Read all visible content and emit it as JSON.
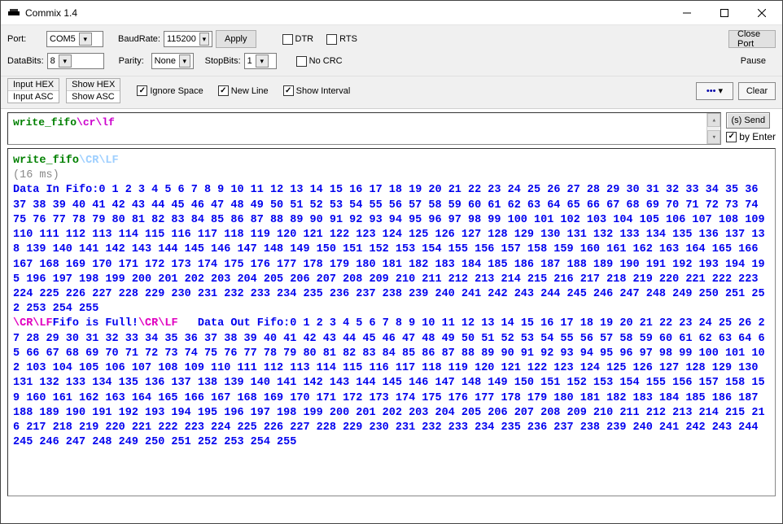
{
  "window": {
    "title": "Commix 1.4"
  },
  "toolbar": {
    "port_label": "Port:",
    "port_value": "COM5",
    "baud_label": "BaudRate:",
    "baud_value": "115200",
    "apply_label": "Apply",
    "dtr_label": "DTR",
    "rts_label": "RTS",
    "close_port_label": "Close Port",
    "databits_label": "DataBits:",
    "databits_value": "8",
    "parity_label": "Parity:",
    "parity_value": "None",
    "stopbits_label": "StopBits:",
    "stopbits_value": "1",
    "nocrc_label": "No CRC",
    "pause_label": "Pause"
  },
  "optbar": {
    "tabs_input": [
      "Input HEX",
      "Input ASC"
    ],
    "tabs_show": [
      "Show HEX",
      "Show ASC"
    ],
    "ignore_space_label": "Ignore Space",
    "newline_label": "New Line",
    "show_interval_label": "Show Interval",
    "more_label": "…",
    "clear_label": "Clear"
  },
  "input": {
    "green": "write_fifo",
    "esc": "\\cr\\lf",
    "send_label": "(s) Send",
    "by_enter_label": "by Enter"
  },
  "console": {
    "echo_green": "write_fifo",
    "echo_esc": "\\CR\\LF",
    "timing": "(16 ms)",
    "data_in_prefix": "Data In Fifo:",
    "data_in_values": "0 1 2 3 4 5 6 7 8 9 10 11 12 13 14 15 16 17 18 19 20 21 22 23 24 25 26 27 28 29 30 31 32 33 34 35 36 37 38 39 40 41 42 43 44 45 46 47 48 49 50 51 52 53 54 55 56 57 58 59 60 61 62 63 64 65 66 67 68 69 70 71 72 73 74 75 76 77 78 79 80 81 82 83 84 85 86 87 88 89 90 91 92 93 94 95 96 97 98 99 100 101 102 103 104 105 106 107 108 109 110 111 112 113 114 115 116 117 118 119 120 121 122 123 124 125 126 127 128 129 130 131 132 133 134 135 136 137 138 139 140 141 142 143 144 145 146 147 148 149 150 151 152 153 154 155 156 157 158 159 160 161 162 163 164 165 166 167 168 169 170 171 172 173 174 175 176 177 178 179 180 181 182 183 184 185 186 187 188 189 190 191 192 193 194 195 196 197 198 199 200 201 202 203 204 205 206 207 208 209 210 211 212 213 214 215 216 217 218 219 220 221 222 223 224 225 226 227 228 229 230 231 232 233 234 235 236 237 238 239 240 241 242 243 244 245 246 247 248 249 250 251 252 253 254 255",
    "crlf1": "\\CR\\LF",
    "fifo_full": "Fifo is Full!",
    "crlf2": "\\CR\\LF",
    "data_out_prefix": "Data Out Fifo:",
    "data_out_values": "0 1 2 3 4 5 6 7 8 9 10 11 12 13 14 15 16 17 18 19 20 21 22 23 24 25 26 27 28 29 30 31 32 33 34 35 36 37 38 39 40 41 42 43 44 45 46 47 48 49 50 51 52 53 54 55 56 57 58 59 60 61 62 63 64 65 66 67 68 69 70 71 72 73 74 75 76 77 78 79 80 81 82 83 84 85 86 87 88 89 90 91 92 93 94 95 96 97 98 99 100 101 102 103 104 105 106 107 108 109 110 111 112 113 114 115 116 117 118 119 120 121 122 123 124 125 126 127 128 129 130 131 132 133 134 135 136 137 138 139 140 141 142 143 144 145 146 147 148 149 150 151 152 153 154 155 156 157 158 159 160 161 162 163 164 165 166 167 168 169 170 171 172 173 174 175 176 177 178 179 180 181 182 183 184 185 186 187 188 189 190 191 192 193 194 195 196 197 198 199 200 201 202 203 204 205 206 207 208 209 210 211 212 213 214 215 216 217 218 219 220 221 222 223 224 225 226 227 228 229 230 231 232 233 234 235 236 237 238 239 240 241 242 243 244 245 246 247 248 249 250 251 252 253 254 255"
  }
}
